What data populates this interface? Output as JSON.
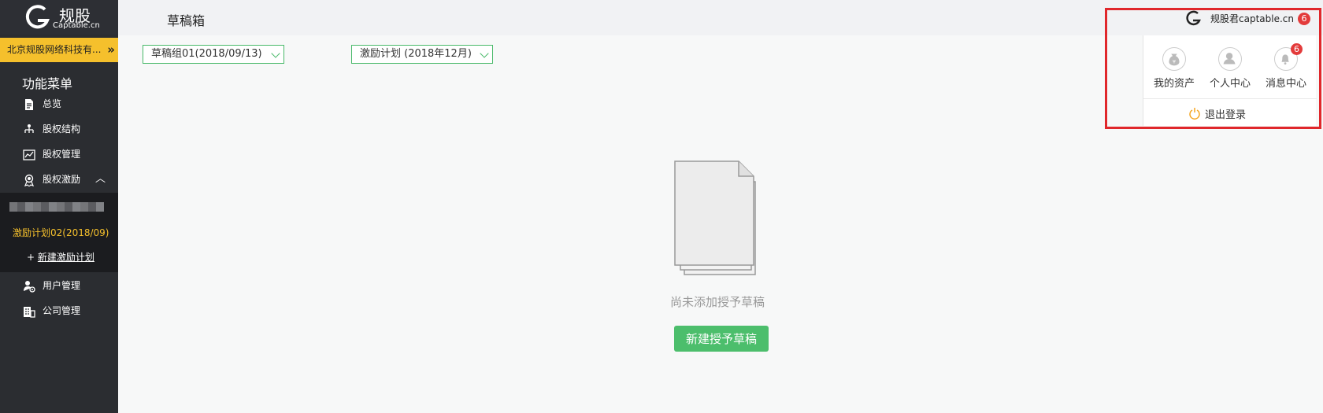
{
  "brand": {
    "name": "规股",
    "sub": "Captable.cn"
  },
  "company": {
    "name": "北京规股网络科技有...",
    "toggle_icon": "double-chevron-right-icon"
  },
  "sidebar": {
    "menu_title": "功能菜单",
    "items": [
      {
        "label": "总览",
        "icon": "document-icon"
      },
      {
        "label": "股权结构",
        "icon": "org-chart-icon"
      },
      {
        "label": "股权管理",
        "icon": "trend-chart-icon"
      },
      {
        "label": "股权激励",
        "icon": "award-icon",
        "caret": "︿"
      },
      {
        "label": "用户管理",
        "icon": "user-settings-icon"
      },
      {
        "label": "公司管理",
        "icon": "building-icon"
      }
    ],
    "submenu": {
      "active_plan": "激励计划02(2018/09)",
      "new_plan_prefix": "+ ",
      "new_plan_label": "新建激励计划"
    }
  },
  "header": {
    "title": "草稿箱",
    "user_name": "规股君captable.cn",
    "notification_count": "6"
  },
  "filters": {
    "draft_group": "草稿组01(2018/09/13)",
    "plan": "激励计划 (2018年12月)"
  },
  "empty_state": {
    "message": "尚未添加授予草稿",
    "button_label": "新建授予草稿"
  },
  "dropdown": {
    "items": [
      {
        "label": "我的资产",
        "icon": "money-bag-icon"
      },
      {
        "label": "个人中心",
        "icon": "user-icon"
      },
      {
        "label": "消息中心",
        "icon": "bell-icon",
        "badge": "6"
      }
    ],
    "logout_label": "退出登录"
  },
  "colors": {
    "sidebar_bg": "#2b2d31",
    "accent_yellow": "#f5c02c",
    "primary_green": "#4cbe6c",
    "badge_red": "#e33b3b",
    "highlight_red": "#e0272b"
  }
}
